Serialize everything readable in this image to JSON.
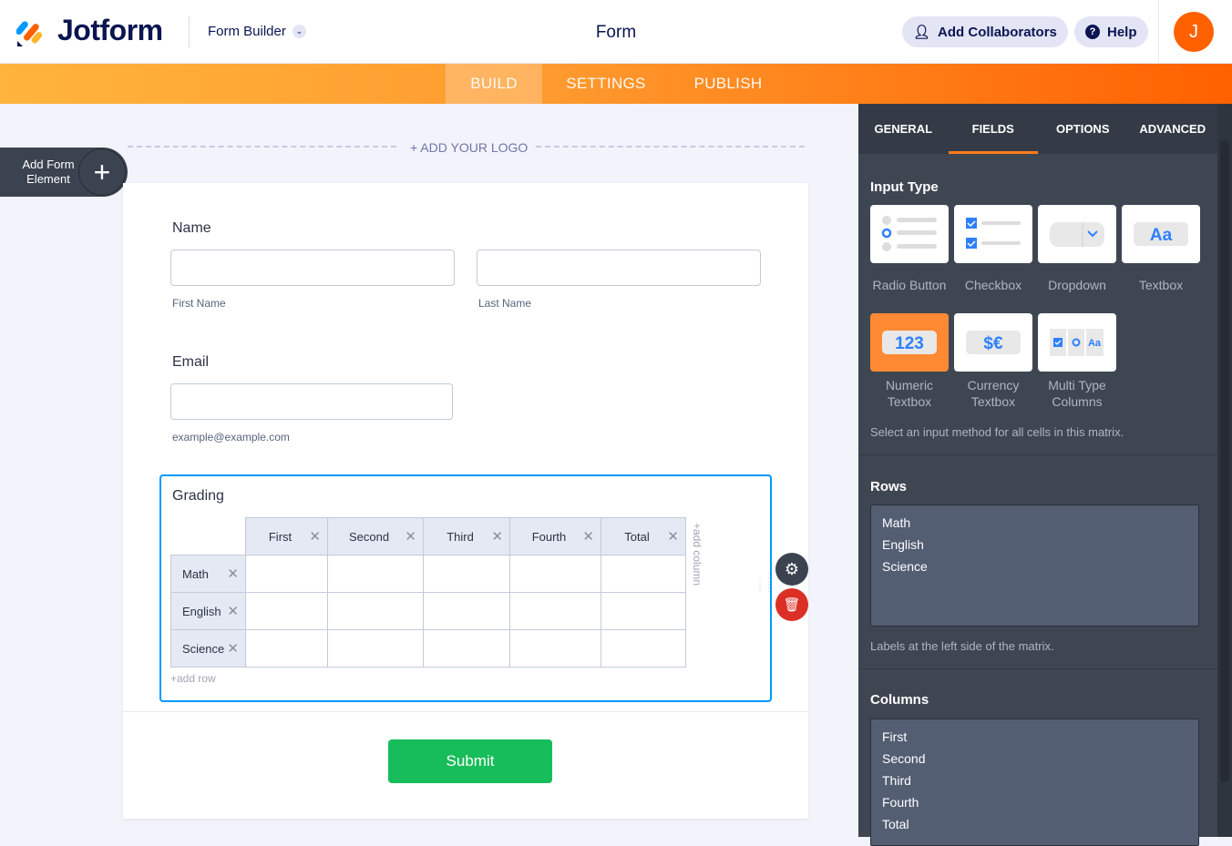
{
  "header": {
    "brand": "Jotform",
    "builder_label": "Form Builder",
    "form_title": "Form",
    "add_collaborators": "Add Collaborators",
    "help": "Help",
    "avatar_initial": "J"
  },
  "nav": {
    "tabs": [
      "BUILD",
      "SETTINGS",
      "PUBLISH"
    ],
    "active": "BUILD"
  },
  "canvas": {
    "add_element_label": "Add Form Element",
    "add_logo": "+ ADD YOUR LOGO"
  },
  "form": {
    "name_label": "Name",
    "first_name_sub": "First Name",
    "last_name_sub": "Last Name",
    "email_label": "Email",
    "email_sub": "example@example.com",
    "matrix": {
      "label": "Grading",
      "columns": [
        "First",
        "Second",
        "Third",
        "Fourth",
        "Total"
      ],
      "rows": [
        "Math",
        "English",
        "Science"
      ],
      "add_column": "+add column",
      "add_row": "+add row"
    },
    "submit": "Submit"
  },
  "panel": {
    "tabs": [
      "GENERAL",
      "FIELDS",
      "OPTIONS",
      "ADVANCED"
    ],
    "active_tab": "FIELDS",
    "input_type": {
      "title": "Input Type",
      "options": [
        "Radio Button",
        "Checkbox",
        "Dropdown",
        "Textbox",
        "Numeric Textbox",
        "Currency Textbox",
        "Multi Type Columns"
      ],
      "selected": "Numeric Textbox",
      "hint": "Select an input method for all cells in this matrix."
    },
    "rows": {
      "title": "Rows",
      "values": [
        "Math",
        "English",
        "Science"
      ],
      "hint": "Labels at the left side of the matrix."
    },
    "columns": {
      "title": "Columns",
      "values": [
        "First",
        "Second",
        "Third",
        "Fourth",
        "Total"
      ]
    }
  },
  "colors": {
    "accent": "#ff6100",
    "selected_tile": "#ff8a33",
    "submit": "#18bd5b",
    "focus": "#0099ff",
    "panel": "#3e4652"
  }
}
